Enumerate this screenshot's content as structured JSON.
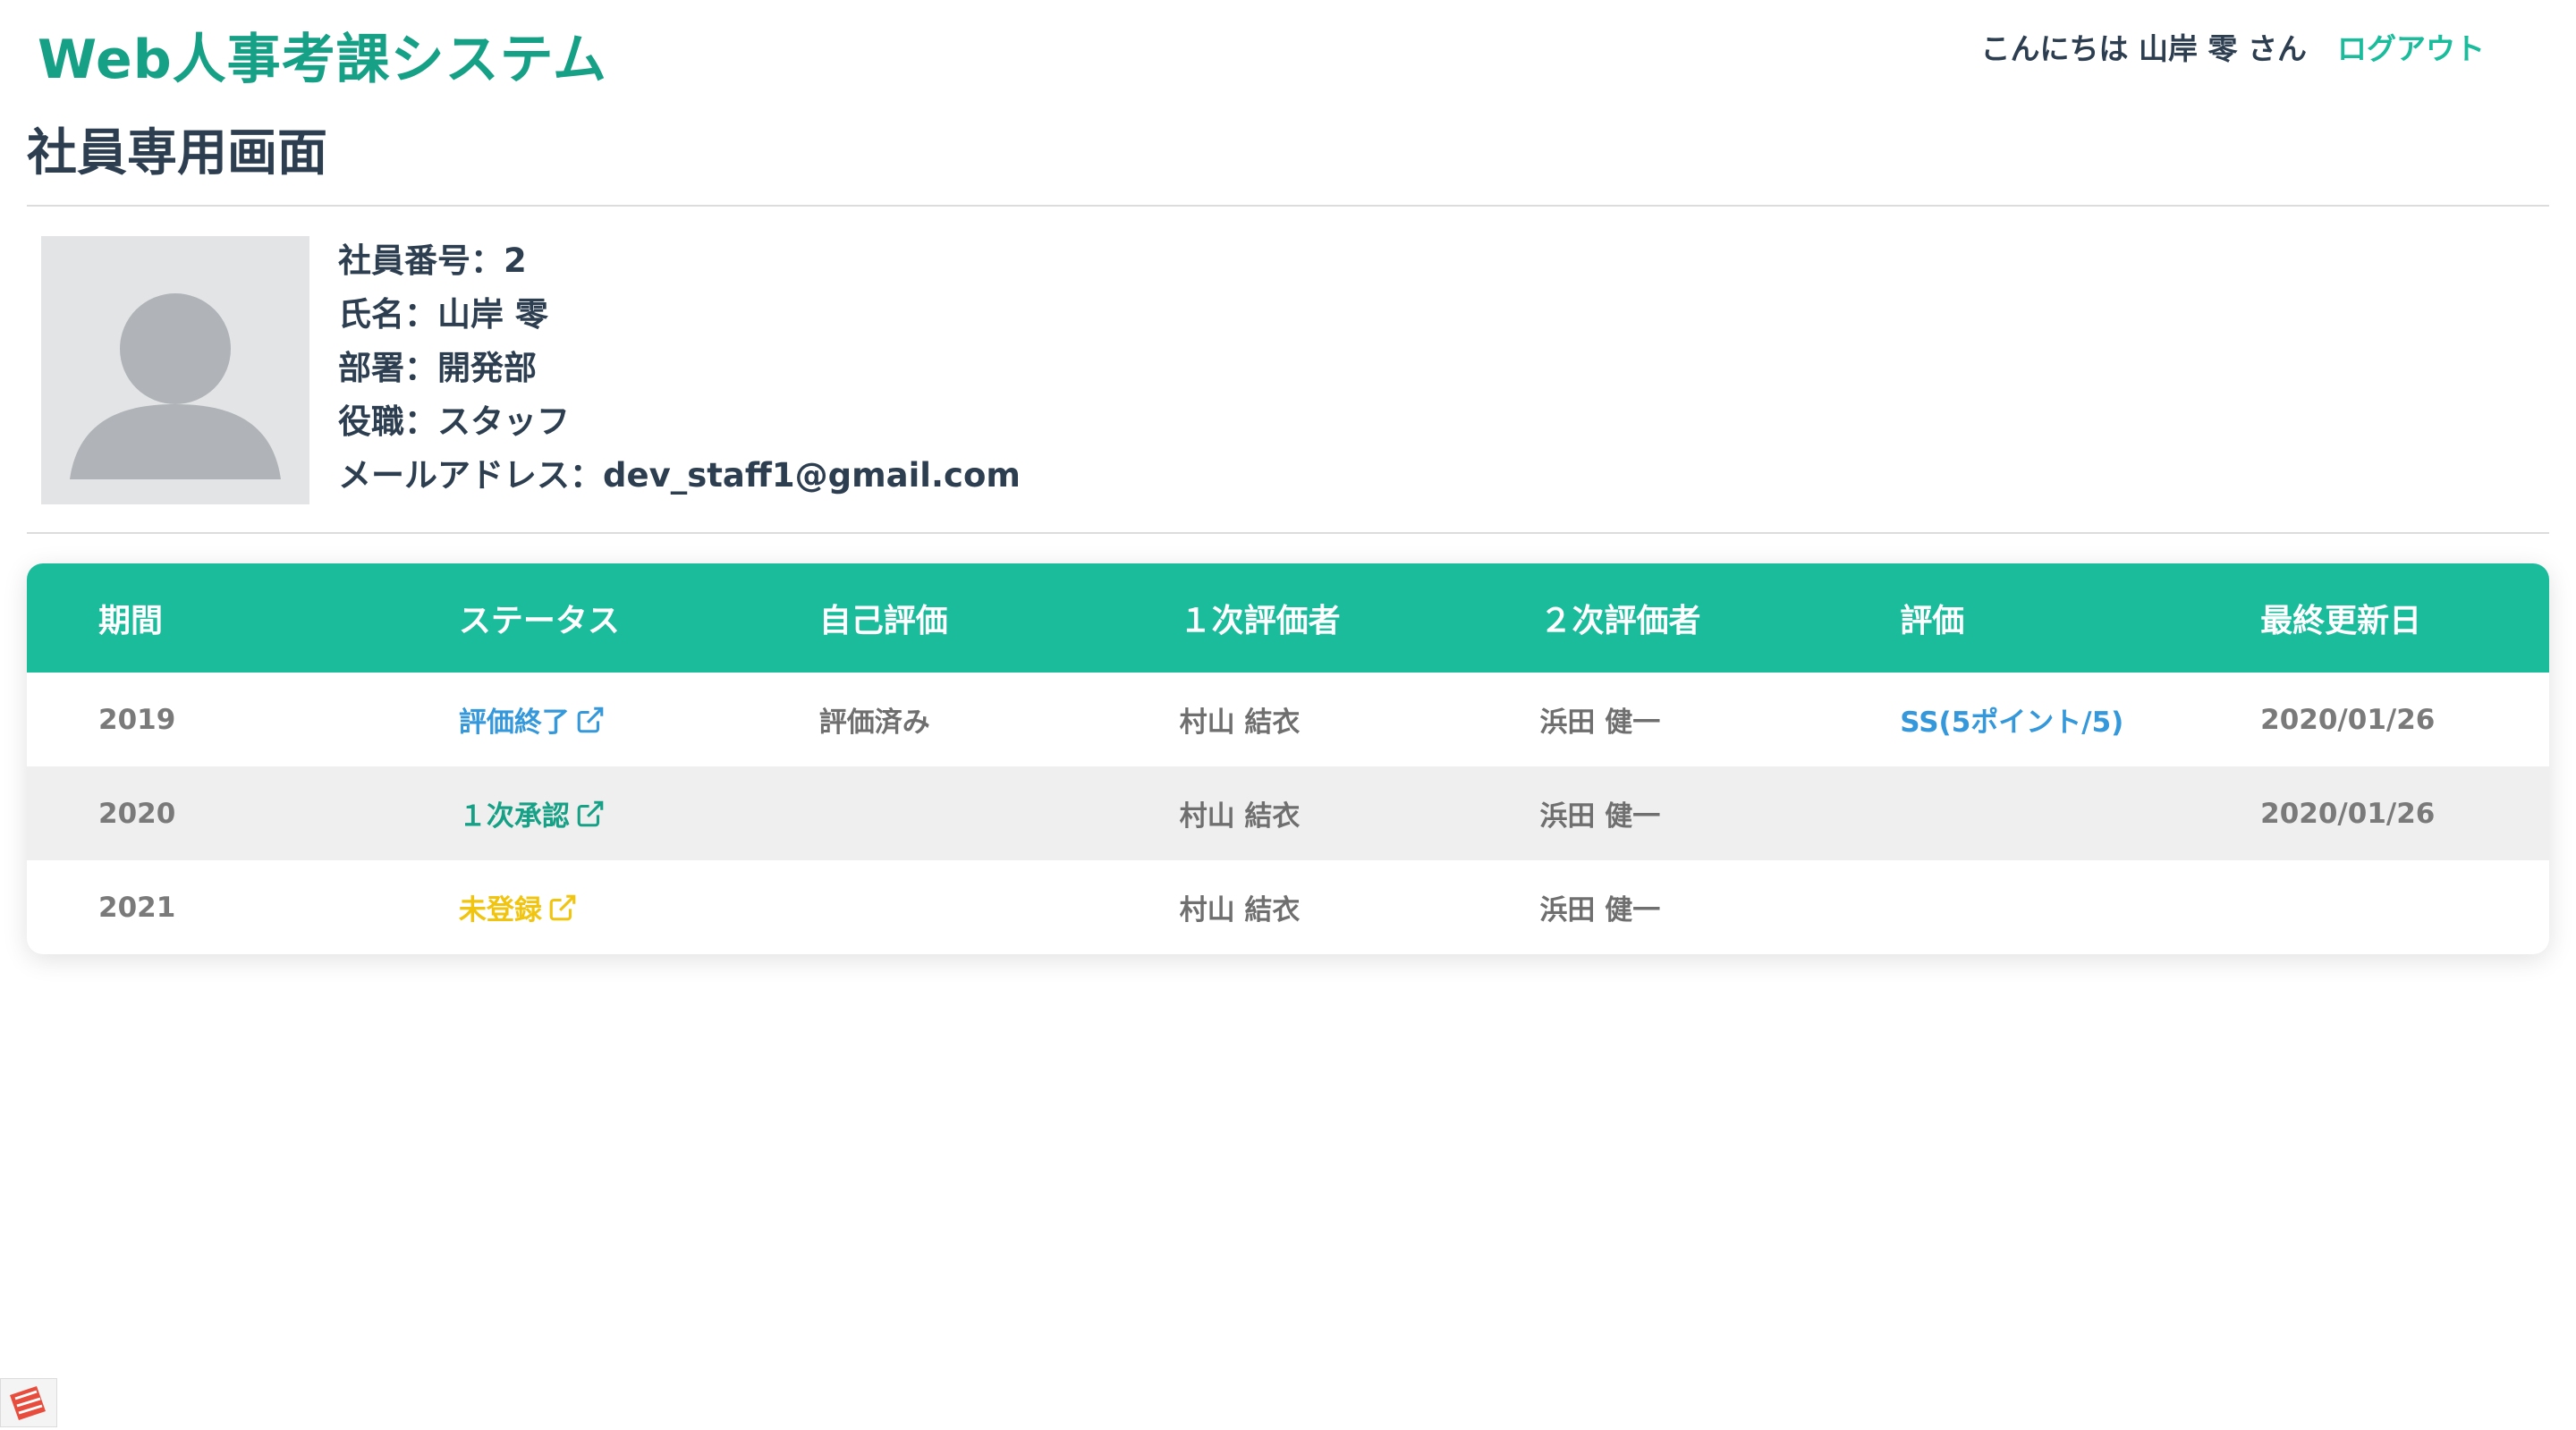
{
  "header": {
    "brand": "Web人事考課システム",
    "greeting": "こんにちは 山岸 零 さん",
    "logout_label": "ログアウト"
  },
  "page": {
    "title": "社員専用画面"
  },
  "profile": {
    "employee_number": "社員番号：2",
    "name": "氏名：山岸 零",
    "department": "部署：開発部",
    "position": "役職：スタッフ",
    "email": "メールアドレス：dev_staff1@gmail.com"
  },
  "table": {
    "columns": [
      "期間",
      "ステータス",
      "自己評価",
      "１次評価者",
      "２次評価者",
      "評価",
      "最終更新日"
    ],
    "rows": [
      {
        "period": "2019",
        "status": "評価終了",
        "self_eval": "評価済み",
        "first_evaluator": "村山 結衣",
        "second_evaluator": "浜田 健一",
        "rating": "SS(5ポイント/5)",
        "updated": "2020/01/26"
      },
      {
        "period": "2020",
        "status": "１次承認",
        "self_eval": "",
        "first_evaluator": "村山 結衣",
        "second_evaluator": "浜田 健一",
        "rating": "",
        "updated": "2020/01/26"
      },
      {
        "period": "2021",
        "status": "未登録",
        "self_eval": "",
        "first_evaluator": "村山 結衣",
        "second_evaluator": "浜田 健一",
        "rating": "",
        "updated": ""
      }
    ]
  },
  "colors": {
    "brand": "#16a085",
    "header_bg": "#1abc9c",
    "status_done": "#3498db",
    "status_first_approval": "#16a085",
    "status_unregistered": "#f1c40f"
  },
  "icons": {
    "external_link": "external-link-icon",
    "avatar": "user-avatar-placeholder",
    "corner": "app-badge-icon"
  }
}
